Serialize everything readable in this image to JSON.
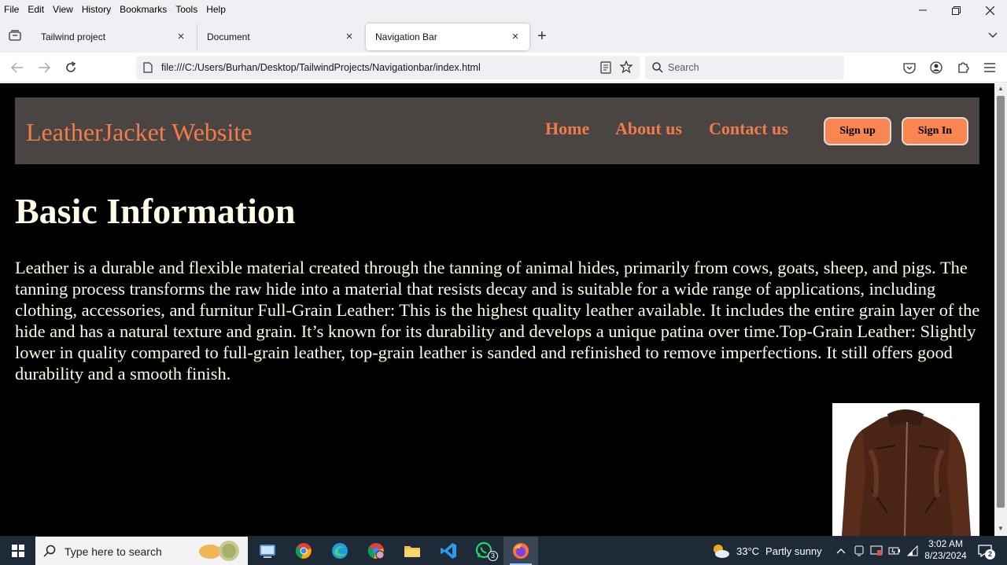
{
  "menu": [
    "File",
    "Edit",
    "View",
    "History",
    "Bookmarks",
    "Tools",
    "Help"
  ],
  "tabs": [
    {
      "title": "Tailwind project"
    },
    {
      "title": "Document"
    },
    {
      "title": "Navigation Bar"
    }
  ],
  "navbar": {
    "url": "file:///C:/Users/Burhan/Desktop/TailwindProjects/Navigationbar/index.html",
    "search_placeholder": "Search"
  },
  "site": {
    "logo": "LeatherJacket Website",
    "links": [
      "Home",
      "About us",
      "Contact us"
    ],
    "signup": "Sign up",
    "signin": "Sign In",
    "heading": "Basic Information",
    "paragraph": "Leather is a durable and flexible material created through the tanning of animal hides, primarily from cows, goats, sheep, and pigs. The tanning process transforms the raw hide into a material that resists decay and is suitable for a wide range of applications, including clothing, accessories, and furnitur Full-Grain Leather: This is the highest quality leather available. It includes the entire grain layer of the hide and has a natural texture and grain. It’s known for its durability and develops a unique patina over time.Top-Grain Leather: Slightly lower in quality compared to full-grain leather, top-grain leather is sanded and refinished to remove imperfections. It still offers good durability and a smooth finish.",
    "colors": {
      "nav_bg": "#4a4543",
      "accent": "#f07c4a",
      "button_bg": "#f98652",
      "text": "#fffbe6",
      "page_bg": "#000000"
    }
  },
  "taskbar": {
    "search_placeholder": "Type here to search",
    "whatsapp_badge": "3",
    "weather": {
      "temp": "33°C",
      "condition": "Partly sunny"
    },
    "time": "3:02 AM",
    "date": "8/23/2024",
    "notification_count": "2",
    "apps": [
      "file-explorer-icon",
      "chrome-icon",
      "edge-icon",
      "chrome-profile-icon",
      "folder-icon",
      "vscode-icon",
      "whatsapp-icon",
      "firefox-icon"
    ]
  }
}
